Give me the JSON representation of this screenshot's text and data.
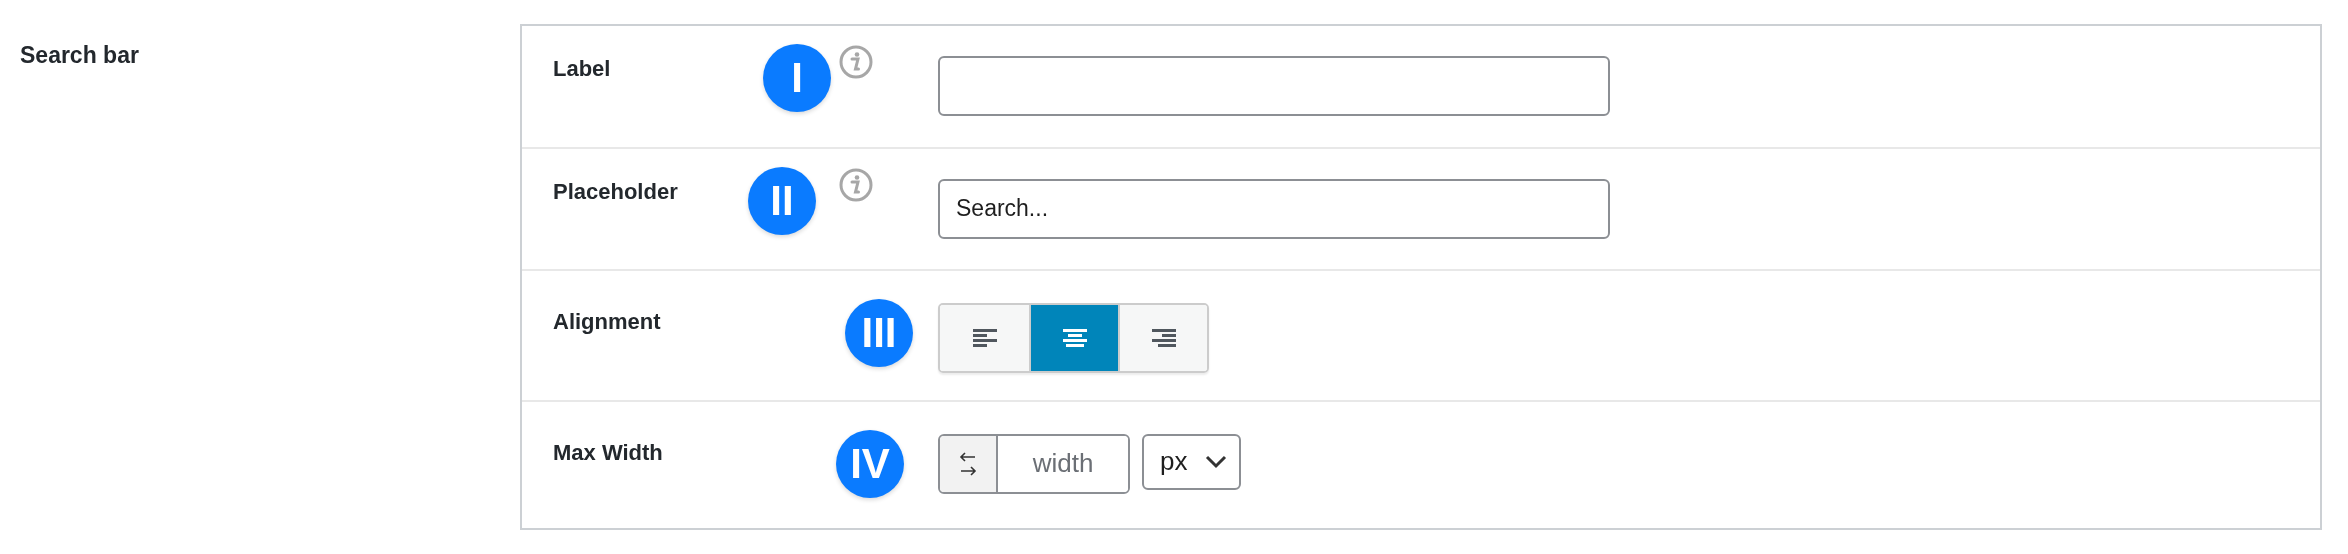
{
  "section_title": "Search bar",
  "rows": [
    {
      "kind": "text",
      "label": "Label",
      "marker": "I",
      "info": true,
      "value": ""
    },
    {
      "kind": "text",
      "label": "Placeholder",
      "marker": "II",
      "info": true,
      "value": "Search..."
    },
    {
      "kind": "alignment",
      "label": "Alignment",
      "marker": "III",
      "options": [
        {
          "kind": "left",
          "selected": false
        },
        {
          "kind": "center",
          "selected": true
        },
        {
          "kind": "right",
          "selected": false
        }
      ]
    },
    {
      "kind": "width",
      "label": "Max Width",
      "marker": "IV",
      "placeholder": "width",
      "unit": "px"
    }
  ]
}
